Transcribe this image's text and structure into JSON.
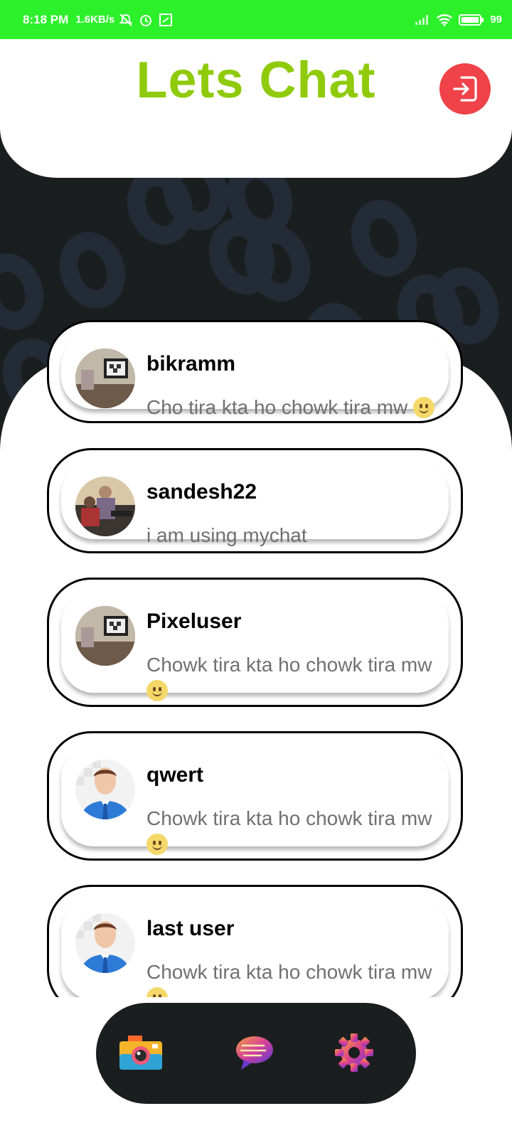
{
  "status_bar": {
    "time": "8:18 PM",
    "speed": "1.6KB/s",
    "battery": "99"
  },
  "header": {
    "title": "Lets Chat",
    "logout_icon": "logout-icon",
    "accent": "#8fcb0a",
    "logout_color": "#ef4349"
  },
  "chats": [
    {
      "name": "bikramm",
      "message": "Cho tira kta ho chowk tira mw",
      "avatar": "room-photo"
    },
    {
      "name": "sandesh22",
      "message": "i am using mychat",
      "avatar": "people-photo"
    },
    {
      "name": "Pixeluser",
      "message": "Chowk tira kta ho chowk tira mw",
      "avatar": "room-photo"
    },
    {
      "name": "qwert",
      "message": "Chowk tira kta ho chowk tira mw",
      "avatar": "default-user-avatar"
    },
    {
      "name": "last user",
      "message": "Chowk tira kta ho chowk tira mw",
      "avatar": "default-user-avatar"
    }
  ],
  "bottom_nav": {
    "items": [
      "camera-icon",
      "chat-icon",
      "settings-icon"
    ]
  }
}
